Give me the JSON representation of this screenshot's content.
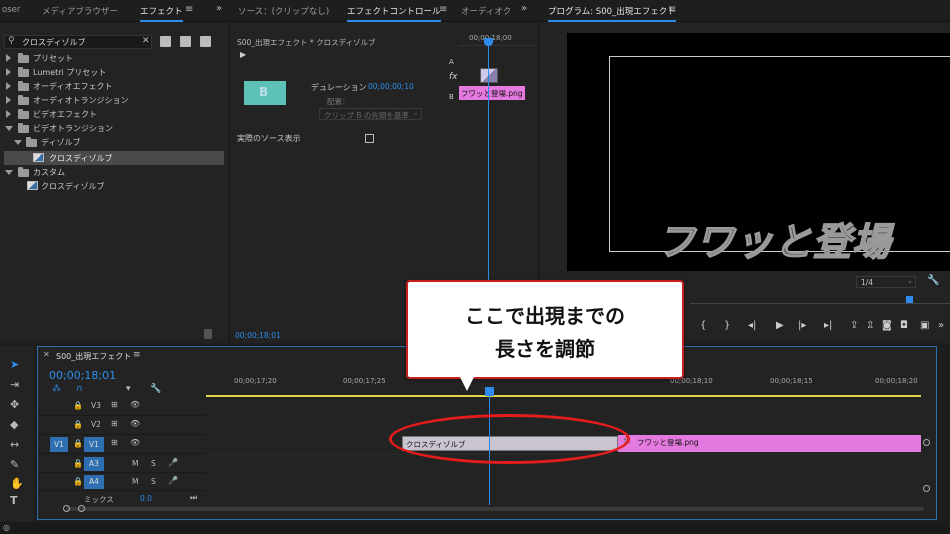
{
  "effects_panel": {
    "tabs": [
      "oser",
      "メディアブラウザー",
      "エフェクト"
    ],
    "active_tab": "エフェクト",
    "search_value": "クロスディゾルブ",
    "tree": [
      {
        "label": "プリセット",
        "level": 0,
        "open": false
      },
      {
        "label": "Lumetri プリセット",
        "level": 0,
        "open": false
      },
      {
        "label": "オーディオエフェクト",
        "level": 0,
        "open": false
      },
      {
        "label": "オーディオトランジション",
        "level": 0,
        "open": false
      },
      {
        "label": "ビデオエフェクト",
        "level": 0,
        "open": false
      },
      {
        "label": "ビデオトランジション",
        "level": 0,
        "open": true
      },
      {
        "label": "ディゾルブ",
        "level": 1,
        "open": true
      },
      {
        "label": "クロスディゾルブ",
        "level": 2,
        "selected": true
      },
      {
        "label": "カスタム",
        "level": 0,
        "open": true
      },
      {
        "label": "クロスディゾルブ",
        "level": 1,
        "selected": false
      }
    ]
  },
  "effect_controls": {
    "tabs": [
      "ソース：(クリップなし)",
      "エフェクトコントロール",
      "オーディオク"
    ],
    "active_tab": "エフェクトコントロール",
    "header": "S00_出現エフェクト * クロスディゾルブ",
    "duration_label": "デュレーション",
    "duration_value": "00;00;00;10",
    "alignment_label": "配置：",
    "alignment_value": "クリップ B の先頭を基準",
    "show_source_label": "実際のソース表示",
    "timecode": "00;00;18;01",
    "mini_ruler": "00;00;18;00",
    "track_a": "A",
    "track_b": "B",
    "fx_label": "fx",
    "clip_name": "フワッと登場.png",
    "thumb_letter": "B"
  },
  "program": {
    "title": "プログラム: S00_出現エフェクト",
    "overlay_text": "フワッと登場",
    "zoom": "1/4"
  },
  "timeline": {
    "title": "S00_出現エフェクト",
    "timecode": "00;00;18;01",
    "ruler": [
      "00;00;17;20",
      "00;00;17;25",
      "00;00;18;10",
      "00;00;18;15",
      "00;00;18;20"
    ],
    "tracks": {
      "v3": "V3",
      "v2": "V2",
      "v1": "V1",
      "v1_src": "V1",
      "a3": "A3",
      "a4": "A4",
      "mute": "M",
      "solo": "S",
      "mix_label": "ミックス",
      "mix_value": "0.0"
    },
    "transition_clip": "クロスディゾルブ",
    "image_clip": "フワッと登場.png"
  },
  "callout": {
    "line1": "ここで出現までの",
    "line2": "長さを調節"
  },
  "colors": {
    "accent": "#2d8ceb",
    "clip_pink": "#e479df",
    "highlight_red": "#e41c1c"
  }
}
